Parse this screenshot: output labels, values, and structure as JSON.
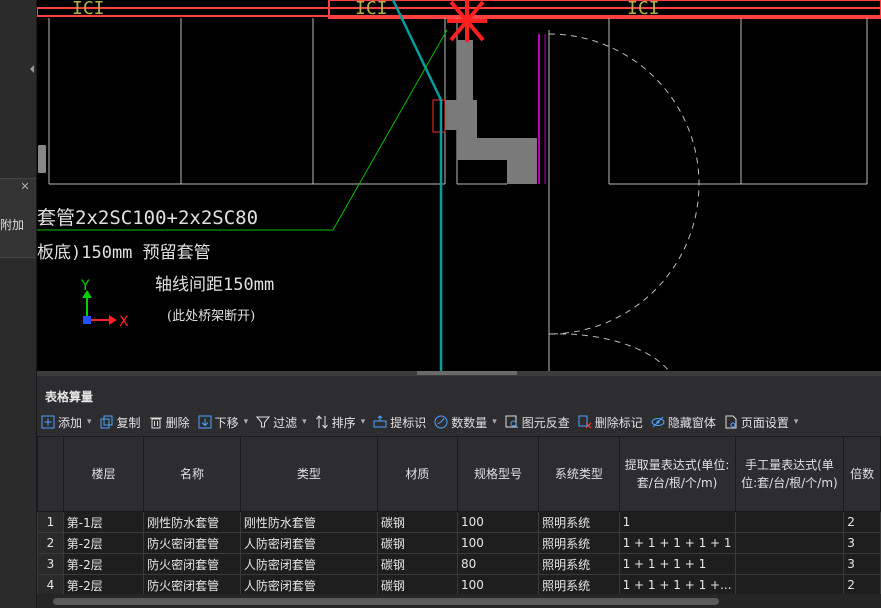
{
  "left_panel": {
    "label": "附加"
  },
  "cad": {
    "label_pipe": "套管2x2SC100+2x2SC80",
    "label_offset": "板底)150mm 预留套管",
    "label_axis_dist": "轴线间距150mm",
    "label_note": "(此处桥架断开)",
    "axis_y": "Y",
    "axis_x": "X",
    "text_tl": "ICI",
    "text_tm": "ICI",
    "text_tr": "ICI"
  },
  "panel": {
    "title": "表格算量",
    "toolbar": [
      {
        "name": "add",
        "label": "添加",
        "icon": "plus-square-icon",
        "caret": true
      },
      {
        "name": "copy",
        "label": "复制",
        "icon": "copy-icon",
        "caret": false
      },
      {
        "name": "delete",
        "label": "删除",
        "icon": "trash-icon",
        "caret": false
      },
      {
        "name": "move-down",
        "label": "下移",
        "icon": "arrow-down-icon",
        "caret": true
      },
      {
        "name": "filter",
        "label": "过滤",
        "icon": "filter-icon",
        "caret": true
      },
      {
        "name": "sort",
        "label": "排序",
        "icon": "sort-icon",
        "caret": true
      },
      {
        "name": "extract-mark",
        "label": "提标识",
        "icon": "tag-icon",
        "caret": false
      },
      {
        "name": "count",
        "label": "数数量",
        "icon": "count-icon",
        "caret": true
      },
      {
        "name": "element-reverse",
        "label": "图元反查",
        "icon": "reverse-lookup-icon",
        "caret": false
      },
      {
        "name": "delete-mark",
        "label": "删除标记",
        "icon": "erase-mark-icon",
        "caret": false
      },
      {
        "name": "hide-window",
        "label": "隐藏窗体",
        "icon": "eye-hidden-icon",
        "caret": false
      },
      {
        "name": "page-setup",
        "label": "页面设置",
        "icon": "page-setup-icon",
        "caret": true
      }
    ],
    "columns": [
      "",
      "楼层",
      "名称",
      "类型",
      "材质",
      "规格型号",
      "系统类型",
      "提取量表达式(单位:套/台/根/个/m)",
      "手工量表达式(单位:套/台/根/个/m)",
      "倍数"
    ],
    "rows": [
      [
        "1",
        "第-1层",
        "刚性防水套管",
        "刚性防水套管",
        "碳钢",
        "100",
        "照明系统",
        "1",
        "",
        "2"
      ],
      [
        "2",
        "第-2层",
        "防火密闭套管",
        "人防密闭套管",
        "碳钢",
        "100",
        "照明系统",
        "1 + 1 + 1 + 1 + 1",
        "",
        "3"
      ],
      [
        "3",
        "第-2层",
        "防火密闭套管",
        "人防密闭套管",
        "碳钢",
        "80",
        "照明系统",
        "1 + 1 + 1 + 1",
        "",
        "3"
      ],
      [
        "4",
        "第-2层",
        "防火密闭套管",
        "人防密闭套管",
        "碳钢",
        "100",
        "照明系统",
        "1 + 1 + 1 + 1 +...",
        "",
        "2"
      ]
    ]
  },
  "colors": {
    "accent": "#3c8fd9",
    "cad_red": "#ff3030",
    "cad_green": "#00c000",
    "cad_cyan": "#00a0a0",
    "cad_magenta": "#c000c0"
  }
}
